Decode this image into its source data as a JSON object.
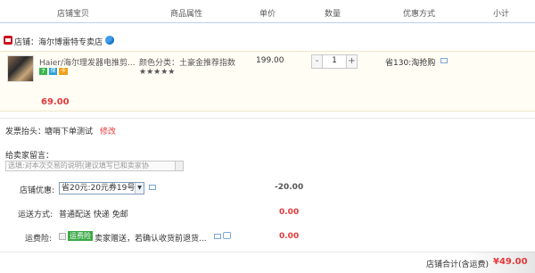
{
  "header": {
    "col_shop_item": "店铺宝贝",
    "col_attrs": "商品属性",
    "col_price": "单价",
    "col_qty": "数量",
    "col_discount": "优惠方式",
    "col_subtotal": "小计"
  },
  "store": {
    "label": "店铺：海尔博雷特专卖店"
  },
  "item": {
    "title": "Haier/海尔理发器电推剪...",
    "attr": "颜色分类：土豪金推荐指数",
    "stars": "★★★★★",
    "unit_price": "199.00",
    "quantity": "1",
    "minus": "-",
    "plus": "+",
    "discount": "省130:淘抢购",
    "subtotal": "69.00",
    "badges": [
      "7",
      "保",
      "卡"
    ],
    "badge_colors": [
      "#3ab54a",
      "#2aa1d9",
      "#f0a01c"
    ]
  },
  "invoice": {
    "label": "发票抬头：",
    "value": "塘哨下单测试",
    "edit": "修改"
  },
  "message": {
    "label": "给卖家留言：",
    "placeholder": "选填:对本次交易的说明(建议填写已和卖家协"
  },
  "store_discount": {
    "label": "店铺优惠:",
    "selected": "省20元:20元券19号f",
    "amount": "-20.00"
  },
  "shipping": {
    "label": "运送方式:",
    "value": "普通配送 快递 免邮",
    "amount": "0.00"
  },
  "insurance": {
    "label": "运费险:",
    "tag": "运费险",
    "text": "卖家赠送，若确认收货前退货...",
    "amount": "0.00"
  },
  "footer": {
    "label": "店铺合计(含运费)",
    "total": "¥49.00"
  },
  "colors": {
    "accent_red": "#e4393c",
    "header_border": "#b5d2ec",
    "green_tag": "#39a845"
  }
}
